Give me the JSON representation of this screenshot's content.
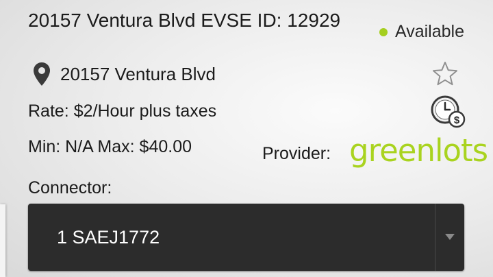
{
  "station": {
    "title": "20157 Ventura Blvd EVSE ID: 12929",
    "status_label": "Available",
    "status_color": "#a5cf1f",
    "address": "20157 Ventura Blvd",
    "rate": "Rate: $2/Hour plus taxes",
    "min_max": "Min: N/A Max: $40.00",
    "provider_label": "Provider:",
    "provider_logo_text": "greenlots",
    "provider_brand_color": "#a9d31f"
  },
  "icons": {
    "location": "map-pin-icon",
    "favorite": "star-icon",
    "pricing": "clock-dollar-icon",
    "dropdown": "chevron-down-icon"
  },
  "connector": {
    "label": "Connector:",
    "selected_value": "1 SAEJ1772"
  }
}
